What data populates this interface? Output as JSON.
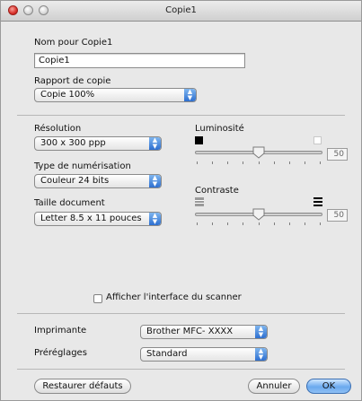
{
  "window": {
    "title": "Copie1"
  },
  "name_section": {
    "label": "Nom pour Copie1",
    "value": "Copie1"
  },
  "ratio_section": {
    "label": "Rapport de copie",
    "selected": "Copie 100%"
  },
  "resolution": {
    "label": "Résolution",
    "selected": "300 x 300 ppp"
  },
  "scan_type": {
    "label": "Type de numérisation",
    "selected": "Couleur 24 bits"
  },
  "doc_size": {
    "label": "Taille document",
    "selected": "Letter  8.5 x 11 pouces"
  },
  "brightness": {
    "label": "Luminosité",
    "value": "50"
  },
  "contrast": {
    "label": "Contraste",
    "value": "50"
  },
  "scanner_ui_checkbox": {
    "label": "Afficher l'interface du scanner",
    "checked": false
  },
  "printer": {
    "label": "Imprimante",
    "selected": "Brother MFC- XXXX"
  },
  "presets": {
    "label": "Préréglages",
    "selected": "Standard"
  },
  "buttons": {
    "restore": "Restaurer défauts",
    "cancel": "Annuler",
    "ok": "OK"
  },
  "colors": {
    "accent": "#2d6fd0",
    "close": "#d9302a"
  },
  "icons": {
    "popup_arrows": "updown-arrows-icon",
    "slider_thumb": "slider-thumb-icon"
  }
}
